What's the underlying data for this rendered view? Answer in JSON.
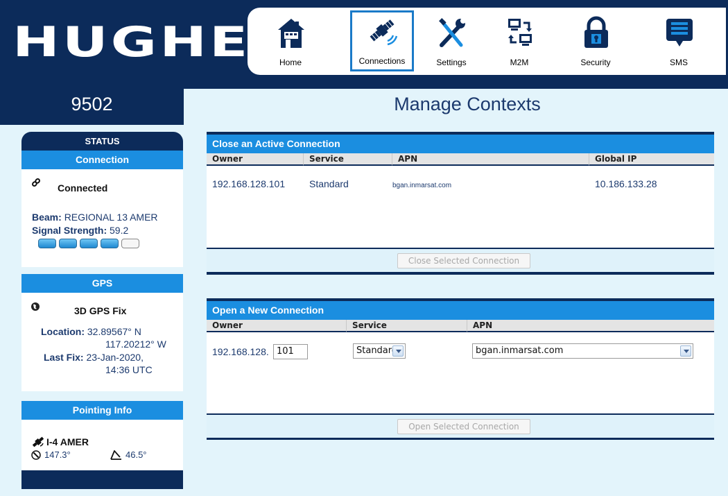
{
  "brand": {
    "logo": "HUGHES",
    "model": "9502"
  },
  "nav": [
    {
      "label": "Home",
      "icon": "home-icon"
    },
    {
      "label": "Connections",
      "icon": "satellite-icon",
      "active": true
    },
    {
      "label": "Settings",
      "icon": "tools-icon"
    },
    {
      "label": "M2M",
      "icon": "m2m-icon"
    },
    {
      "label": "Security",
      "icon": "lock-icon"
    },
    {
      "label": "SMS",
      "icon": "message-icon"
    }
  ],
  "page_title": "Manage Contexts",
  "sidebar": {
    "status_title": "STATUS",
    "connection": {
      "title": "Connection",
      "state": "Connected",
      "beam_label": "Beam:",
      "beam_value": "REGIONAL 13 AMER",
      "signal_label": "Signal Strength:",
      "signal_value": "59.2",
      "signal_bars_lit": 4,
      "signal_bars_total": 5
    },
    "gps": {
      "title": "GPS",
      "state": "3D GPS Fix",
      "location_label": "Location:",
      "location_lat": "32.89567° N",
      "location_lon": "117.20212° W",
      "last_fix_label": "Last Fix:",
      "last_fix_date": "23-Jan-2020,",
      "last_fix_time": "14:36 UTC"
    },
    "pointing": {
      "title": "Pointing Info",
      "satellite": "I-4 AMER",
      "azimuth": "147.3°",
      "elevation": "46.5°"
    }
  },
  "active_connection": {
    "title": "Close an Active Connection",
    "columns": [
      "Owner",
      "Service",
      "APN",
      "Global IP"
    ],
    "rows": [
      {
        "owner": "192.168.128.101",
        "service": "Standard",
        "apn": "bgan.inmarsat.com",
        "global_ip": "10.186.133.28"
      }
    ],
    "button": "Close Selected Connection"
  },
  "new_connection": {
    "title": "Open a New Connection",
    "columns": [
      "Owner",
      "Service",
      "APN"
    ],
    "owner_prefix": "192.168.128.",
    "owner_suffix": "101",
    "service_selected": "Standard",
    "apn_selected": "bgan.inmarsat.com",
    "button": "Open Selected Connection"
  },
  "colors": {
    "navy": "#0c2b5a",
    "accent_blue": "#1b8ee0",
    "background": "#e3f4fb"
  }
}
